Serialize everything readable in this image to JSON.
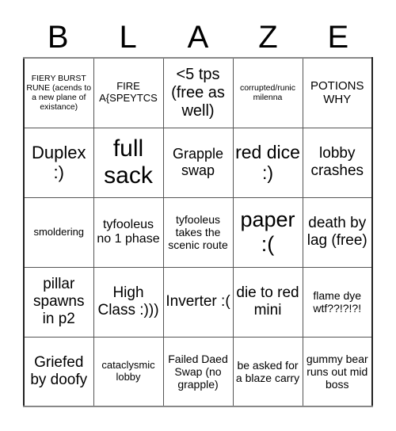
{
  "title_letters": [
    "B",
    "L",
    "A",
    "Z",
    "E"
  ],
  "rows": [
    [
      "FIERY BURST RUNE (acends to a new plane of existance)",
      "FIRE A{SPEYTCS",
      "<5 tps (free as well)",
      "corrupted/runic milenna",
      "POTIONS WHY"
    ],
    [
      "Duplex :)",
      "full sack",
      "Grapple swap",
      "red dice :)",
      "lobby crashes"
    ],
    [
      "smoldering",
      "tyfooleus no 1 phase",
      "tyfooleus takes the scenic route",
      "paper :(",
      "death by lag (free)"
    ],
    [
      "pillar spawns in p2",
      "High Class :)))",
      "Inverter :(",
      "die to red mini",
      "flame dye wtf??!?!?!"
    ],
    [
      "Griefed by doofy",
      "cataclysmic lobby",
      "Failed Daed Swap (no grapple)",
      "be asked for a blaze carry",
      "gummy bear runs out mid boss"
    ]
  ]
}
